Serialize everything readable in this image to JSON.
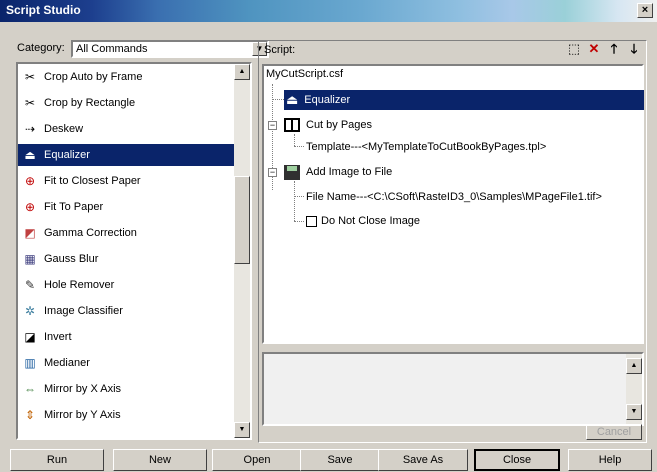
{
  "window": {
    "title": "Script Studio",
    "close_glyph": "×"
  },
  "left": {
    "category_label": "Category:",
    "category_value": "All Commands",
    "items": [
      {
        "label": "Crop Auto by Frame",
        "icon": "crop-auto-icon",
        "glyph": "✂",
        "color": "#000000"
      },
      {
        "label": "Crop by Rectangle",
        "icon": "crop-rect-icon",
        "glyph": "✂",
        "color": "#000000"
      },
      {
        "label": "Deskew",
        "icon": "deskew-icon",
        "glyph": "⇢",
        "color": "#000000"
      },
      {
        "label": "Equalizer",
        "icon": "equalizer-icon",
        "glyph": "⏏",
        "color": "#ffffff"
      },
      {
        "label": "Fit to Closest Paper",
        "icon": "fit-paper-icon",
        "glyph": "⊕",
        "color": "#c00000"
      },
      {
        "label": "Fit To Paper",
        "icon": "fit-to-paper-icon",
        "glyph": "⊕",
        "color": "#c00000"
      },
      {
        "label": "Gamma Correction",
        "icon": "gamma-icon",
        "glyph": "◩",
        "color": "#c04040"
      },
      {
        "label": "Gauss Blur",
        "icon": "gauss-blur-icon",
        "glyph": "▦",
        "color": "#404080"
      },
      {
        "label": "Hole Remover",
        "icon": "hole-remover-icon",
        "glyph": "✎",
        "color": "#303030"
      },
      {
        "label": "Image Classifier",
        "icon": "image-classifier-icon",
        "glyph": "✲",
        "color": "#4080a0"
      },
      {
        "label": "Invert",
        "icon": "invert-icon",
        "glyph": "◪",
        "color": "#000000"
      },
      {
        "label": "Medianer",
        "icon": "medianer-icon",
        "glyph": "▥",
        "color": "#2060a0"
      },
      {
        "label": "Mirror by X Axis",
        "icon": "mirror-x-icon",
        "glyph": "⇔",
        "color": "#408040"
      },
      {
        "label": "Mirror by Y Axis",
        "icon": "mirror-y-icon",
        "glyph": "⇕",
        "color": "#c06000"
      }
    ],
    "selected_index": 3
  },
  "script": {
    "label": "Script:",
    "filename": "MyCutScript.csf",
    "nodes": {
      "equalizer": "Equalizer",
      "cut_by_pages": "Cut by Pages",
      "template": "Template---<MyTemplateToCutBookByPages.tpl>",
      "add_image": "Add Image to File",
      "file_name": "File Name---<C:\\CSoft\\RasteID3_0\\Samples\\MPageFile1.tif>",
      "do_not_close": "Do Not Close Image"
    },
    "cancel_label": "Cancel"
  },
  "buttons": {
    "run": "Run",
    "new": "New",
    "open": "Open",
    "save": "Save",
    "save_as": "Save As",
    "close": "Close",
    "help": "Help"
  }
}
